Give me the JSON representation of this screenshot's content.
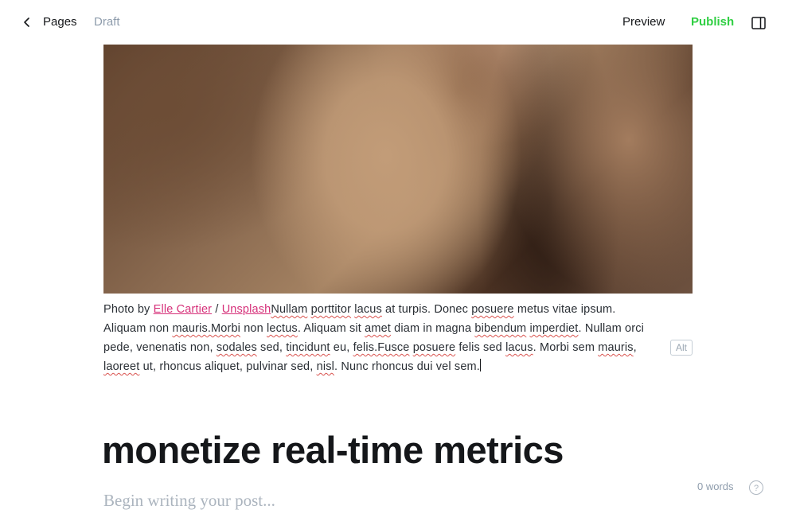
{
  "header": {
    "breadcrumb_label": "Pages",
    "status": "Draft",
    "preview_label": "Preview",
    "publish_label": "Publish"
  },
  "caption": {
    "prefix": "Photo by ",
    "author_link": "Elle Cartier",
    "separator": " / ",
    "source_link": "Unsplash",
    "segments": [
      {
        "t": "Nullam",
        "sq": true
      },
      {
        "t": " "
      },
      {
        "t": "porttitor",
        "sq": true
      },
      {
        "t": " "
      },
      {
        "t": "lacus",
        "sq": true
      },
      {
        "t": " at turpis. Donec "
      },
      {
        "t": "posuere",
        "sq": true
      },
      {
        "t": " metus vitae ipsum. Aliquam non "
      },
      {
        "t": "mauris.Morbi",
        "sq": true
      },
      {
        "t": " non "
      },
      {
        "t": "lectus",
        "sq": true
      },
      {
        "t": ". Aliquam sit "
      },
      {
        "t": "amet",
        "sq": true
      },
      {
        "t": " diam in magna "
      },
      {
        "t": "bibendum",
        "sq": true
      },
      {
        "t": " "
      },
      {
        "t": "imperdiet",
        "sq": true
      },
      {
        "t": ". Nullam orci pede, venenatis non, "
      },
      {
        "t": "sodales",
        "sq": true
      },
      {
        "t": " sed, "
      },
      {
        "t": "tincidunt",
        "sq": true
      },
      {
        "t": " eu, "
      },
      {
        "t": "felis.Fusce",
        "sq": true
      },
      {
        "t": " "
      },
      {
        "t": "posuere",
        "sq": true
      },
      {
        "t": " felis sed "
      },
      {
        "t": "lacus",
        "sq": true
      },
      {
        "t": ". Morbi sem "
      },
      {
        "t": "mauris",
        "sq": true
      },
      {
        "t": ", "
      },
      {
        "t": "laoreet",
        "sq": true
      },
      {
        "t": " ut, rhoncus aliquet, pulvinar sed, "
      },
      {
        "t": "nisl",
        "sq": true
      },
      {
        "t": ". Nunc rhoncus dui vel sem."
      }
    ]
  },
  "image_alt_label": "Alt",
  "post": {
    "title": "monetize real-time metrics",
    "body_placeholder": "Begin writing your post..."
  },
  "footer": {
    "word_count": "0 words",
    "help_label": "?"
  }
}
